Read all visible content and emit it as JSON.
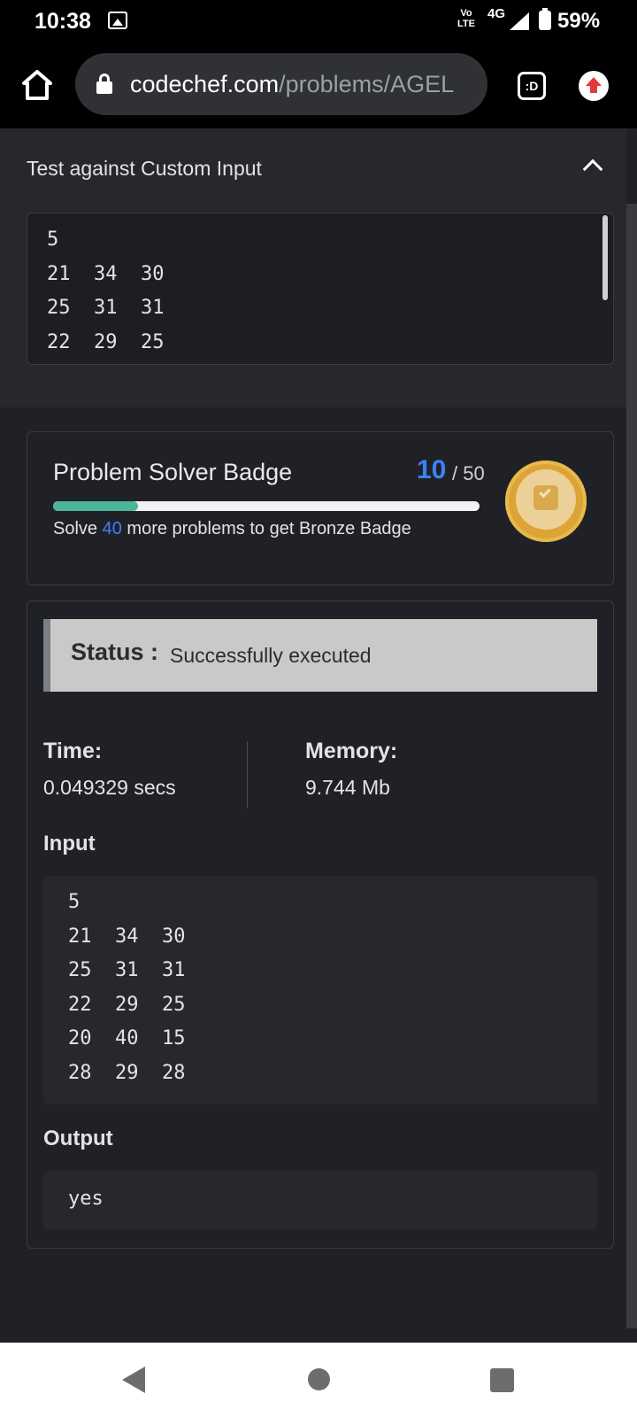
{
  "statusbar": {
    "time": "10:38",
    "volte_top": "Vo",
    "volte_bottom": "LTE",
    "network": "4G",
    "battery": "59%",
    "icons": [
      "image-icon",
      "volte-icon",
      "signal-icon",
      "battery-icon"
    ]
  },
  "browser": {
    "url_host": "codechef.com",
    "url_path": "/problems/AGEL",
    "tabs_label": ":D",
    "icons": [
      "home-icon",
      "lock-icon",
      "tab-switcher-icon",
      "update-menu-icon"
    ]
  },
  "custom_input": {
    "title": "Test against Custom Input",
    "text": "5\n21  34  30\n25  31  31\n22  29  25"
  },
  "badge": {
    "title": "Problem Solver Badge",
    "solved": "10",
    "total": "/ 50",
    "progress_fraction": 0.2,
    "note_prefix": "Solve",
    "remaining": "40",
    "note_suffix": "more problems to get Bronze Badge",
    "icons": [
      "bronze-medal-icon"
    ],
    "colors": {
      "accent": "#3b82f6",
      "progress": "#4cb59a",
      "medal": "#dca436"
    }
  },
  "result": {
    "status_label": "Status :",
    "status_value": "Successfully executed",
    "time_label": "Time:",
    "time_value": "0.049329 secs",
    "memory_label": "Memory:",
    "memory_value": "9.744 Mb",
    "input_label": "Input",
    "input_text": "5\n21  34  30\n25  31  31\n22  29  25\n20  40  15\n28  29  28",
    "output_label": "Output",
    "output_text": "yes"
  },
  "navbar": {
    "icons": [
      "back-icon",
      "home-circle-icon",
      "recents-icon"
    ]
  }
}
